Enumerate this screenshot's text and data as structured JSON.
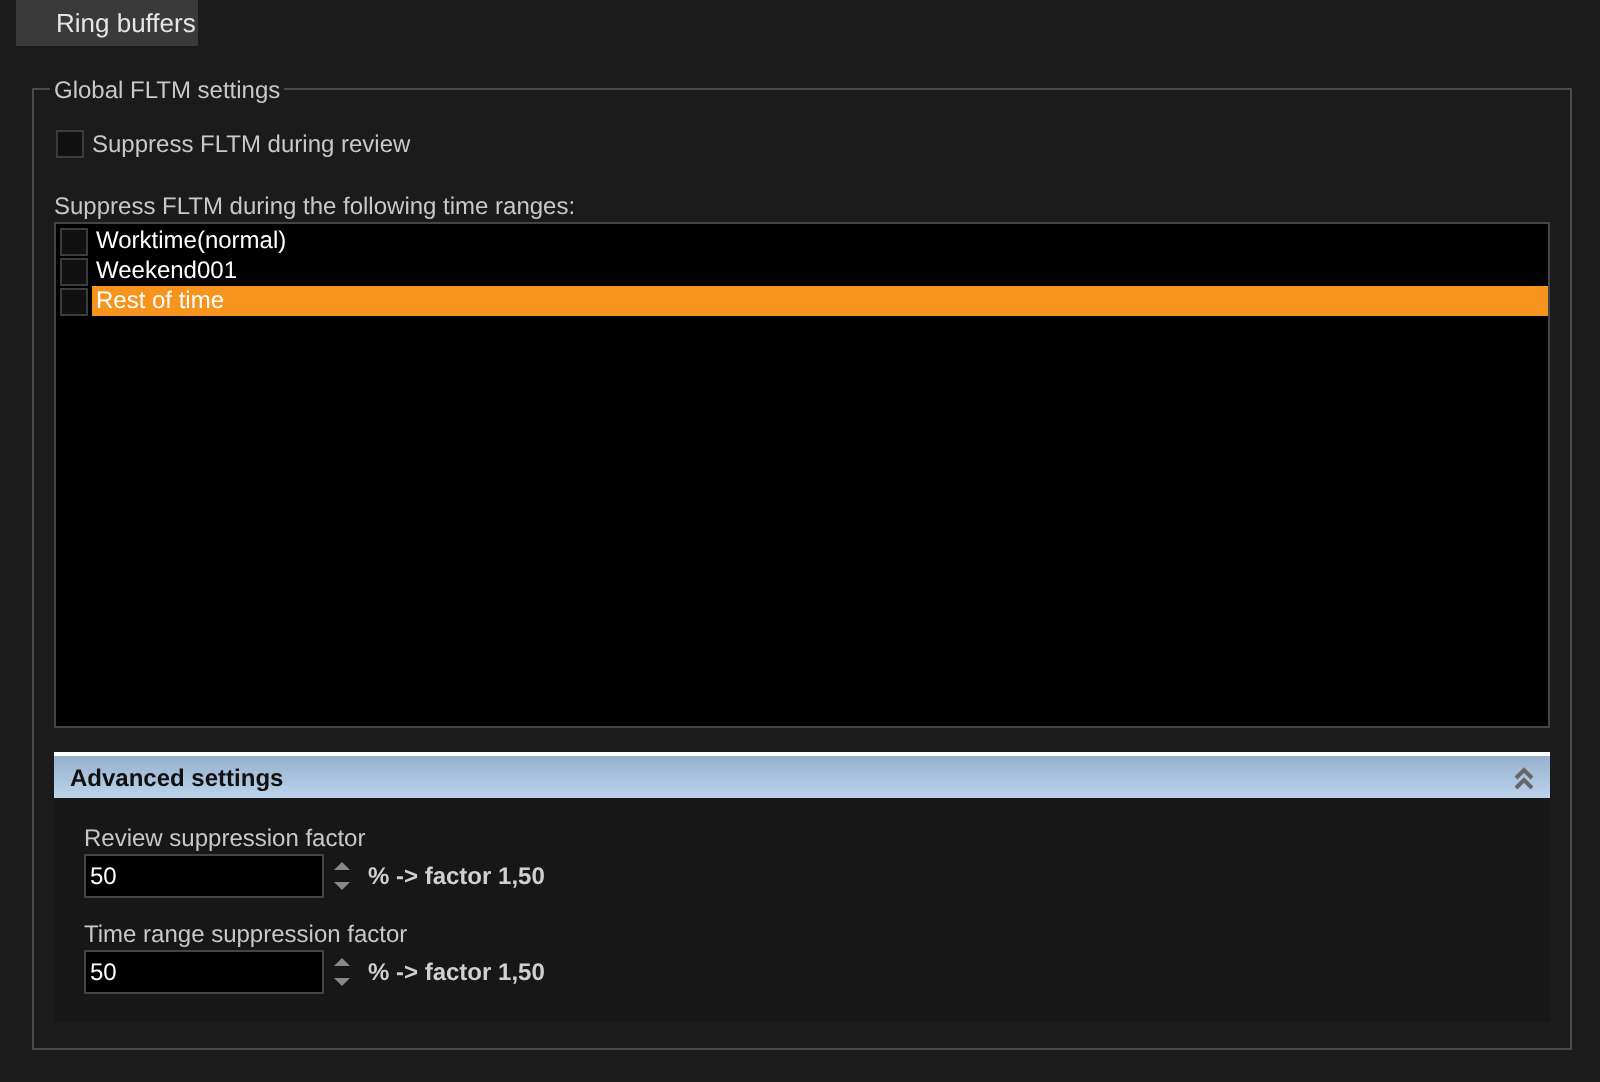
{
  "tab": {
    "label": "Ring buffers"
  },
  "group": {
    "title": "Global FLTM settings",
    "suppress_review": {
      "label": "Suppress FLTM during review",
      "checked": false
    },
    "ranges_label": "Suppress FLTM during the following time ranges:",
    "ranges": [
      {
        "label": "Worktime(normal)",
        "checked": false,
        "selected": false
      },
      {
        "label": "Weekend001",
        "checked": false,
        "selected": false
      },
      {
        "label": "Rest of time",
        "checked": false,
        "selected": true
      }
    ],
    "advanced": {
      "title": "Advanced settings",
      "expanded": true,
      "fields": [
        {
          "label": "Review suppression factor",
          "value": "50",
          "result": "% -> factor 1,50"
        },
        {
          "label": "Time range suppression factor",
          "value": "50",
          "result": "% -> factor 1,50"
        }
      ]
    }
  }
}
